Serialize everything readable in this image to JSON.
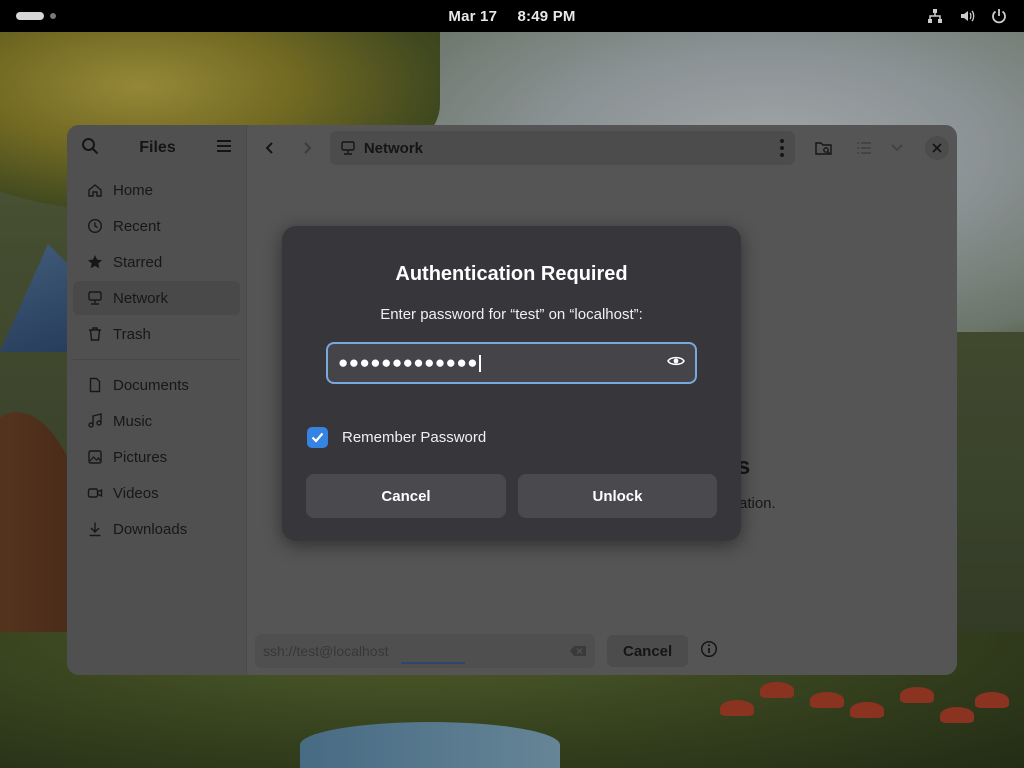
{
  "topbar": {
    "date": "Mar 17",
    "time": "8:49 PM",
    "icons": [
      "network-icon",
      "volume-icon",
      "power-icon"
    ]
  },
  "files": {
    "app_title": "Files",
    "sidebar": {
      "items": [
        {
          "label": "Home",
          "icon": "home-icon"
        },
        {
          "label": "Recent",
          "icon": "clock-icon"
        },
        {
          "label": "Starred",
          "icon": "star-icon"
        },
        {
          "label": "Network",
          "icon": "network-icon",
          "active": true
        },
        {
          "label": "Trash",
          "icon": "trash-icon"
        }
      ],
      "bookmarks": [
        {
          "label": "Documents",
          "icon": "document-icon"
        },
        {
          "label": "Music",
          "icon": "music-icon"
        },
        {
          "label": "Pictures",
          "icon": "picture-icon"
        },
        {
          "label": "Videos",
          "icon": "video-icon"
        },
        {
          "label": "Downloads",
          "icon": "download-icon"
        }
      ]
    },
    "path": "Network",
    "empty_title_partial": "s",
    "empty_sub_partial": "ation.",
    "footer": {
      "address_placeholder": "ssh://test@localhost",
      "cancel_label": "Cancel"
    }
  },
  "dialog": {
    "title": "Authentication Required",
    "message": "Enter password for “test” on “localhost”:",
    "password_masked": "●●●●●●●●●●●●●",
    "remember_label": "Remember Password",
    "remember_checked": true,
    "cancel_label": "Cancel",
    "unlock_label": "Unlock"
  },
  "colors": {
    "accent": "#3584e4",
    "focus_ring": "#7aa7dd",
    "dialog_bg": "#37373b"
  }
}
